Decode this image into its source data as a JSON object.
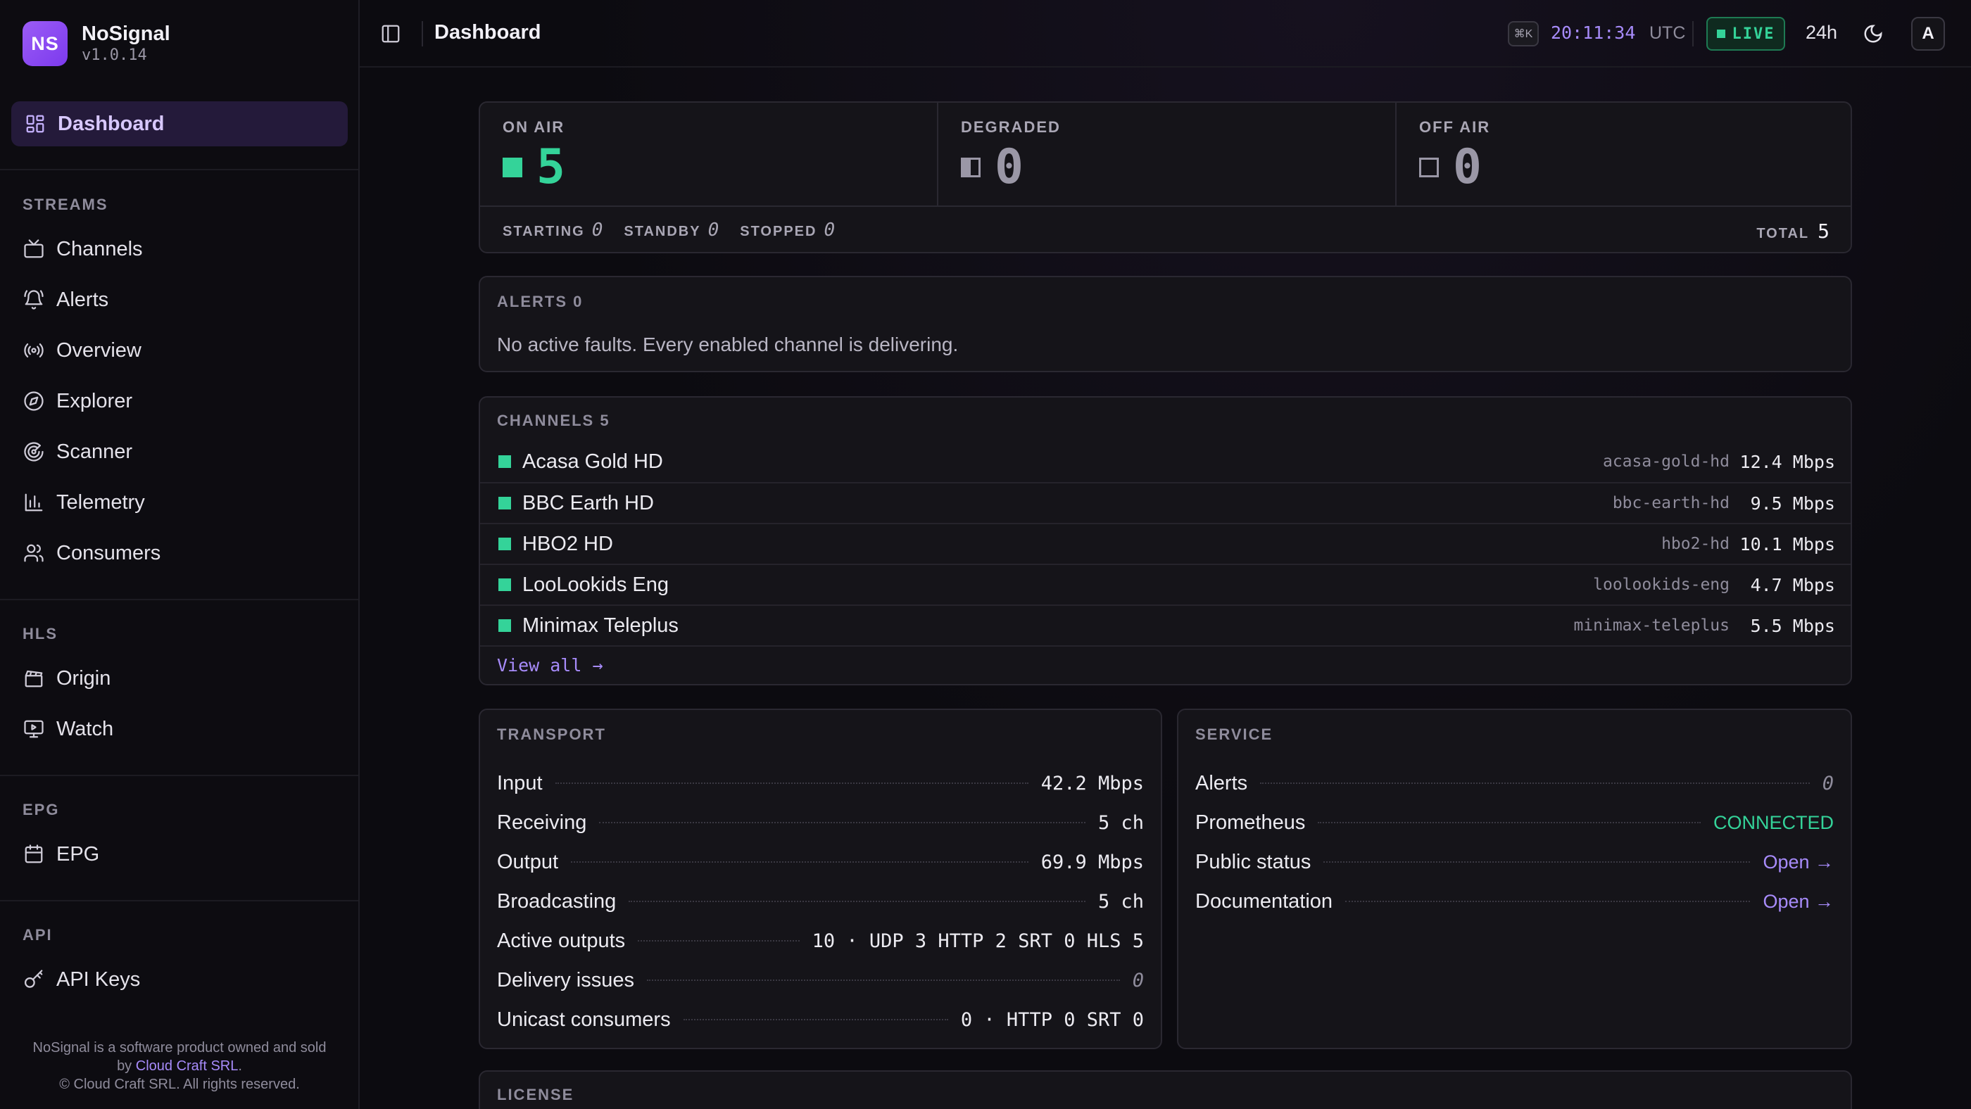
{
  "brand": {
    "logo": "NS",
    "name": "NoSignal",
    "version": "v1.0.14"
  },
  "sidebar": {
    "active": {
      "label": "Dashboard",
      "icon": "dashboard-icon"
    },
    "sections": {
      "streams": {
        "title": "STREAMS",
        "items": [
          "Channels",
          "Alerts",
          "Overview",
          "Explorer",
          "Scanner",
          "Telemetry",
          "Consumers"
        ]
      },
      "hls": {
        "title": "HLS",
        "items": [
          "Origin",
          "Watch"
        ]
      },
      "epg": {
        "title": "EPG",
        "items": [
          "EPG"
        ]
      },
      "api": {
        "title": "API",
        "items": [
          "API Keys"
        ]
      }
    },
    "footer": {
      "line1": "NoSignal is a software product owned and sold",
      "by": "by",
      "company_link": "Cloud Craft SRL",
      "period": ".",
      "line3": "© Cloud Craft SRL. All rights reserved."
    }
  },
  "topbar": {
    "title": "Dashboard",
    "shortcut": "⌘K",
    "clock": "20:11:34",
    "timezone": "UTC",
    "live": "LIVE",
    "range": "24h",
    "avatar": "A"
  },
  "status": {
    "on_air": {
      "label": "ON AIR",
      "value": "5"
    },
    "degraded": {
      "label": "DEGRADED",
      "value": "0"
    },
    "off_air": {
      "label": "OFF AIR",
      "value": "0"
    },
    "starting": {
      "label": "STARTING",
      "value": "0"
    },
    "standby": {
      "label": "STANDBY",
      "value": "0"
    },
    "stopped": {
      "label": "STOPPED",
      "value": "0"
    },
    "total": {
      "label": "TOTAL",
      "value": "5"
    }
  },
  "alerts": {
    "title": "ALERTS 0",
    "message": "No active faults. Every enabled channel is delivering."
  },
  "channels": {
    "title": "CHANNELS 5",
    "rows": [
      {
        "name": "Acasa Gold HD",
        "slug": "acasa-gold-hd",
        "rate": "12.4 Mbps"
      },
      {
        "name": "BBC Earth HD",
        "slug": "bbc-earth-hd",
        "rate": "9.5 Mbps"
      },
      {
        "name": "HBO2 HD",
        "slug": "hbo2-hd",
        "rate": "10.1 Mbps"
      },
      {
        "name": "LooLookids Eng",
        "slug": "loolookids-eng",
        "rate": "4.7 Mbps"
      },
      {
        "name": "Minimax Teleplus",
        "slug": "minimax-teleplus",
        "rate": "5.5 Mbps"
      }
    ],
    "view_all": "View all →"
  },
  "transport": {
    "title": "TRANSPORT",
    "rows": [
      {
        "k": "Input",
        "v": "42.2 Mbps"
      },
      {
        "k": "Receiving",
        "v": "5 ch"
      },
      {
        "k": "Output",
        "v": "69.9 Mbps"
      },
      {
        "k": "Broadcasting",
        "v": "5 ch"
      },
      {
        "k": "Active outputs",
        "v": "10 · UDP 3 HTTP 2 SRT 0 HLS 5"
      },
      {
        "k": "Delivery issues",
        "v": "0"
      },
      {
        "k": "Unicast consumers",
        "v": "0 · HTTP 0 SRT 0"
      }
    ]
  },
  "service": {
    "title": "SERVICE",
    "rows": [
      {
        "k": "Alerts",
        "v": "0"
      },
      {
        "k": "Prometheus",
        "v": "CONNECTED"
      },
      {
        "k": "Public status",
        "v": "Open →"
      },
      {
        "k": "Documentation",
        "v": "Open →"
      }
    ]
  },
  "license": {
    "title": "LICENSE"
  },
  "colors": {
    "accent": "#a78bfa",
    "brand": "#8b5cf6",
    "ok": "#34d399",
    "bg": "#0c0b10",
    "card": "#151419"
  }
}
